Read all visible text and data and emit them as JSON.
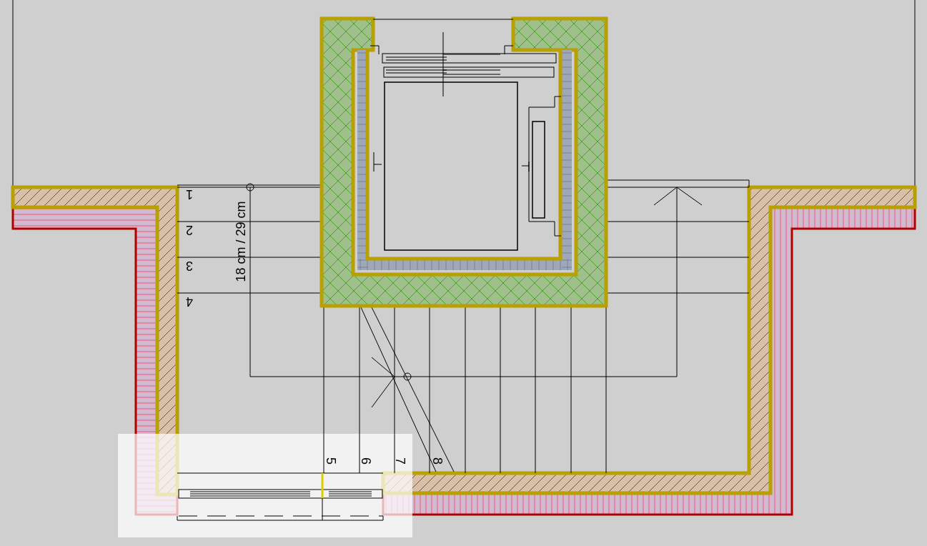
{
  "step_numbers": [
    {
      "text": "1",
      "kind": "inverted"
    },
    {
      "text": "2",
      "kind": "inverted"
    },
    {
      "text": "3",
      "kind": "inverted"
    },
    {
      "text": "4",
      "kind": "inverted"
    },
    {
      "text": "5",
      "kind": "sideways"
    },
    {
      "text": "6",
      "kind": "sideways"
    },
    {
      "text": "7",
      "kind": "sideways"
    },
    {
      "text": "8",
      "kind": "sideways"
    }
  ],
  "dimension_label": "18 cm / 29 cm"
}
